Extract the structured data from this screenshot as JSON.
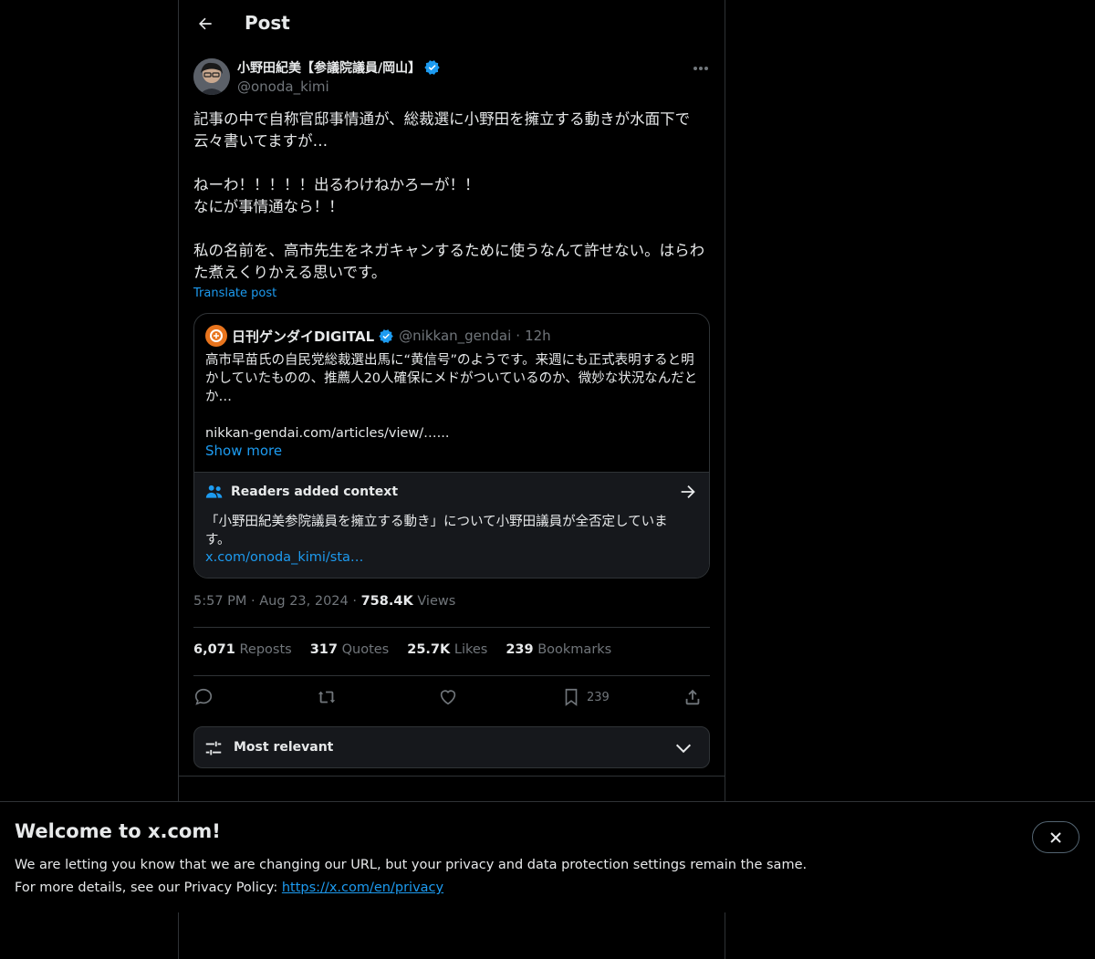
{
  "header": {
    "title": "Post"
  },
  "author": {
    "name": "小野田紀美【参議院議員/岡山】",
    "handle": "@onoda_kimi",
    "verified_color": "#1d9bf0"
  },
  "post": {
    "text": "記事の中で自称官邸事情通が、総裁選に小野田を擁立する動きが水面下で云々書いてますが…\n\nねーわ！！！！！出るわけねかろーが！！\nなにが事情通なら！！\n\n私の名前を、高市先生をネガキャンするために使うなんて許せない。はらわた煮えくりかえる思いです。",
    "translate_label": "Translate post"
  },
  "quote": {
    "name": "日刊ゲンダイDIGITAL",
    "handle": "@nikkan_gendai",
    "separator": "·",
    "time": "12h",
    "text": "高市早苗氏の自民党総裁選出馬に“黄信号”のようです。来週にも正式表明すると明かしていたものの、推薦人20人確保にメドがついているのか、微妙な状況なんだとか…\n\nnikkan-gendai.com/articles/view/…...",
    "show_more": "Show more"
  },
  "context": {
    "title": "Readers added context",
    "text": "「小野田紀美参院議員を擁立する動き」について小野田議員が全否定しています。",
    "link": "x.com/onoda_kimi/sta…"
  },
  "meta": {
    "time": "5:57 PM",
    "dot1": "·",
    "date": "Aug 23, 2024",
    "dot2": "·",
    "views_count": "758.4K",
    "views_label": "Views"
  },
  "stats": {
    "reposts_count": "6,071",
    "reposts_label": "Reposts",
    "quotes_count": "317",
    "quotes_label": "Quotes",
    "likes_count": "25.7K",
    "likes_label": "Likes",
    "bookmarks_count": "239",
    "bookmarks_label": "Bookmarks"
  },
  "actions": {
    "reply_icon": "reply-icon",
    "repost_icon": "repost-icon",
    "like_icon": "heart-icon",
    "bookmark_icon": "bookmark-icon",
    "bookmark_count": "239",
    "share_icon": "share-icon"
  },
  "sort": {
    "label": "Most relevant"
  },
  "banner": {
    "title": "Welcome to x.com!",
    "line1": "We are letting you know that we are changing our URL, but your privacy and data protection settings remain the same.",
    "line2_prefix": "For more details, see our Privacy Policy: ",
    "link": "https://x.com/en/privacy"
  },
  "colors": {
    "background": "#000000",
    "text": "#e7e9ea",
    "muted": "#71767b",
    "accent": "#1d9bf0",
    "border": "#2f3336"
  }
}
